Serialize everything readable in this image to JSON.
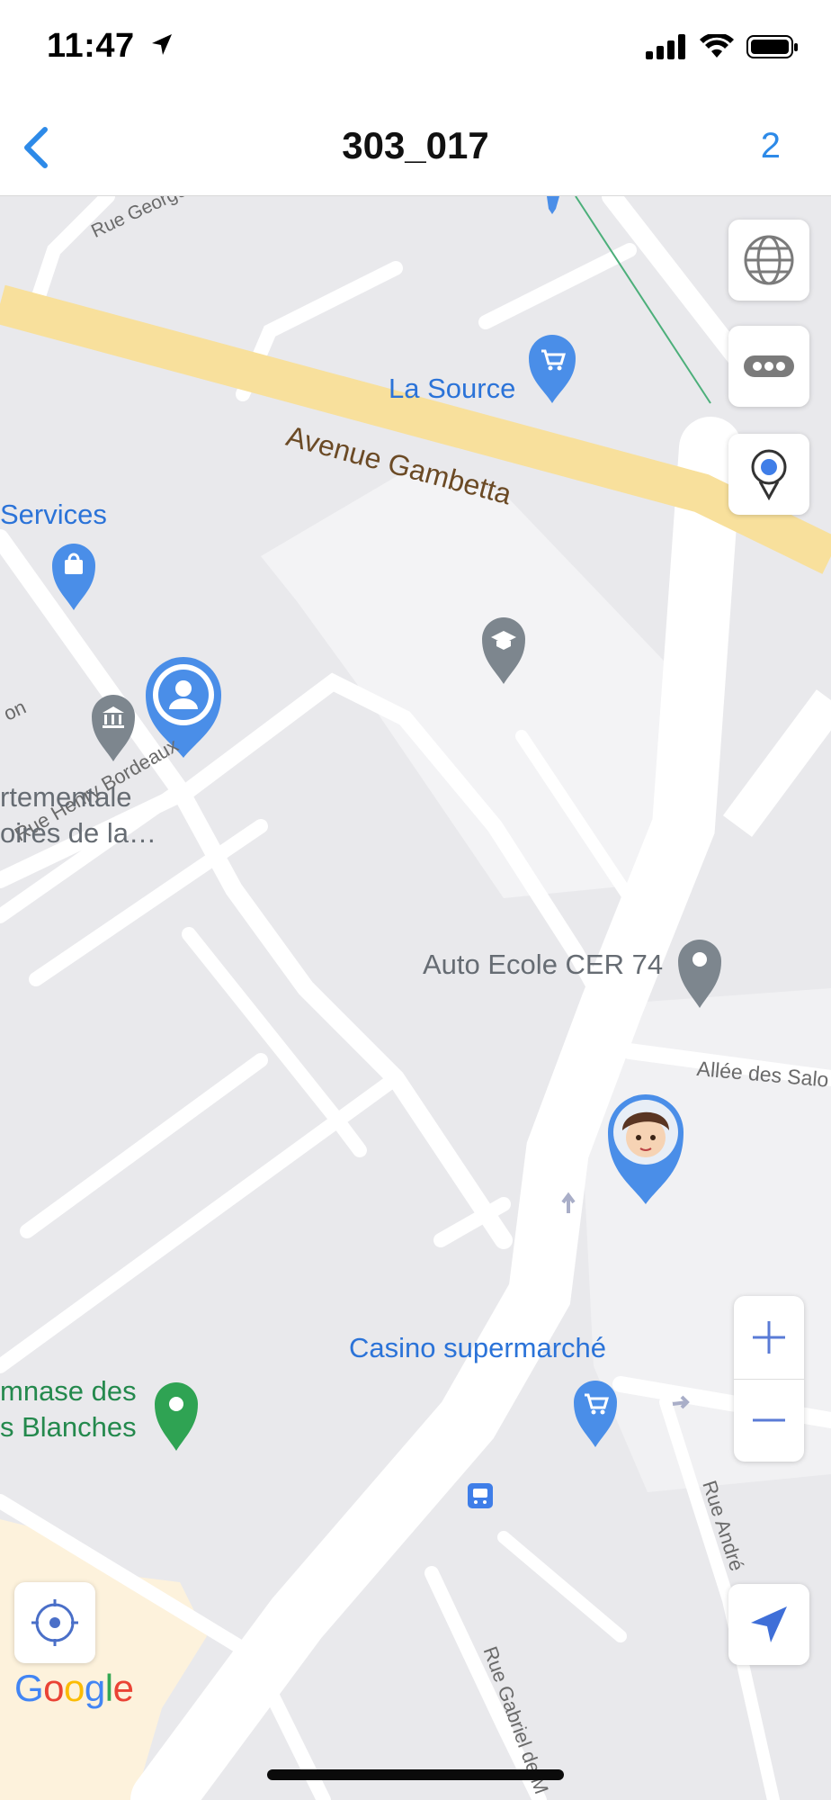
{
  "status_bar": {
    "time": "11:47"
  },
  "nav": {
    "title": "303_017",
    "count": "2"
  },
  "map": {
    "streets": {
      "avenue_gambetta": "Avenue Gambetta",
      "rue_georges": "Rue Georges Mar",
      "rue_henry_bordeaux": "Rue Henry Bordeaux",
      "allee_des": "Allée des Salo",
      "rue_andre": "Rue André",
      "rue_gabriel": "Rue Gabriel de M",
      "on": "on"
    },
    "places": {
      "la_source": "La Source",
      "services": "Services",
      "dept_line1": "rtementale",
      "dept_line2": "oires de la…",
      "auto_ecole": "Auto Ecole CER 74",
      "casino": "Casino supermarché",
      "gymnase_line1": "mnase des",
      "gymnase_line2": "s Blanches"
    },
    "attribution": "Google",
    "colors": {
      "map_bg": "#e9e9ec",
      "road": "#ffffff",
      "main_road": "#fbe5a3",
      "poi_blue": "#4a8ee8",
      "poi_gray": "#7d868e",
      "poi_green": "#2fa353",
      "accent": "#2d8ae8"
    }
  }
}
